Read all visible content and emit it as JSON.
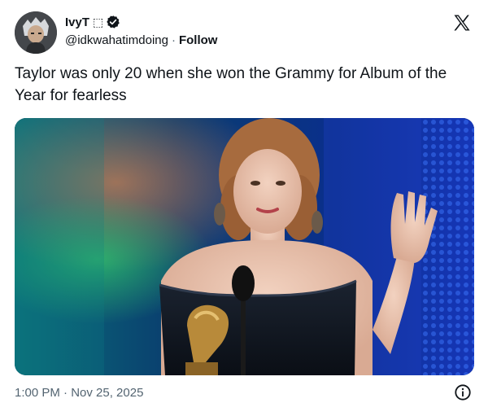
{
  "author": {
    "display_name": "IvyT ",
    "display_name_glyph": "⬚",
    "handle": "@idkwahatimdoing",
    "separator": "·",
    "follow_label": "Follow"
  },
  "tweet": {
    "text": "Taylor was only 20 when she won the Grammy for Album of the Year for fearless"
  },
  "footer": {
    "timestamp": "1:00 PM · Nov 25, 2025"
  },
  "icons": {
    "verified": "verified-badge-icon",
    "brand": "x-logo-icon",
    "info": "info-icon"
  },
  "colors": {
    "text_primary": "#0f1419",
    "text_secondary": "#536471"
  }
}
